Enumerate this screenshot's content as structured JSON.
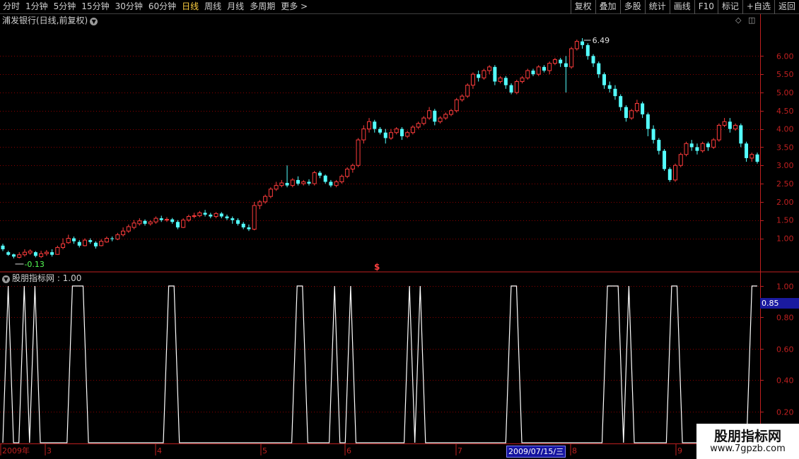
{
  "toolbar": {
    "periods": [
      "分时",
      "1分钟",
      "5分钟",
      "15分钟",
      "30分钟",
      "60分钟",
      "日线",
      "周线",
      "月线",
      "多周期",
      "更多 >"
    ],
    "active_period": "日线",
    "actions": [
      "复权",
      "叠加",
      "多股",
      "统计",
      "画线",
      "F10",
      "标记",
      "+自选",
      "返回"
    ]
  },
  "main_chart": {
    "title": "浦发银行(日线,前复权)",
    "high_label": "6.49",
    "low_label": "-0.13",
    "marker": "$",
    "y_ticks": [
      "6.00",
      "5.50",
      "5.00",
      "4.50",
      "4.00",
      "3.50",
      "3.00",
      "2.50",
      "2.00",
      "1.50",
      "1.00"
    ]
  },
  "indicator": {
    "title": "股朋指标网 : 1.00",
    "current_value": "0.85",
    "y_ticks": [
      "1.00",
      "0.80",
      "0.60",
      "0.40",
      "0.20"
    ]
  },
  "time_axis": {
    "labels": [
      "2009年",
      "3",
      "4",
      "5",
      "6",
      "7",
      "8",
      "9"
    ],
    "cursor_date": "2009/07/15/三"
  },
  "watermark": {
    "title": "股朋指标网",
    "url": "www.7gpzb.com"
  },
  "colors": {
    "up": "#ff3c3c",
    "down": "#54ffff",
    "grid": "#8a0000",
    "axis": "#c02020",
    "line": "#ffffff"
  },
  "chart_data": [
    {
      "type": "candlestick",
      "title": "浦发银行(日线,前复权)",
      "ylim": [
        0.1,
        6.8
      ],
      "y_ticks": [
        1.0,
        1.5,
        2.0,
        2.5,
        3.0,
        3.5,
        4.0,
        4.5,
        5.0,
        5.5,
        6.0
      ],
      "annotations": [
        {
          "text": "6.49",
          "kind": "max"
        },
        {
          "text": "-0.13",
          "kind": "min"
        }
      ],
      "series": [
        {
          "points": [
            [
              0.8,
              0.7,
              0.85,
              0.65
            ],
            [
              0.62,
              0.55,
              0.66,
              0.52
            ],
            [
              0.56,
              0.5,
              0.58,
              0.45
            ],
            [
              0.48,
              0.55,
              0.62,
              0.45
            ],
            [
              0.55,
              0.62,
              0.7,
              0.5
            ],
            [
              0.6,
              0.65,
              0.7,
              0.55
            ],
            [
              0.62,
              0.52,
              0.65,
              0.48
            ],
            [
              0.5,
              0.58,
              0.66,
              0.46
            ],
            [
              0.58,
              0.62,
              0.68,
              0.52
            ],
            [
              0.62,
              0.55,
              0.7,
              0.5
            ],
            [
              0.56,
              0.75,
              0.8,
              0.55
            ],
            [
              0.75,
              0.85,
              1.0,
              0.7
            ],
            [
              0.88,
              1.0,
              1.1,
              0.85
            ],
            [
              1.0,
              0.92,
              1.05,
              0.85
            ],
            [
              0.9,
              0.8,
              0.95,
              0.75
            ],
            [
              0.8,
              0.95,
              1.0,
              0.78
            ],
            [
              0.95,
              0.9,
              1.0,
              0.85
            ],
            [
              0.88,
              0.78,
              0.92,
              0.72
            ],
            [
              0.8,
              0.92,
              0.98,
              0.78
            ],
            [
              0.9,
              1.0,
              1.05,
              0.88
            ],
            [
              1.0,
              0.98,
              1.05,
              0.92
            ],
            [
              0.98,
              1.1,
              1.15,
              0.95
            ],
            [
              1.1,
              1.2,
              1.3,
              1.05
            ],
            [
              1.2,
              1.32,
              1.38,
              1.15
            ],
            [
              1.3,
              1.42,
              1.5,
              1.25
            ],
            [
              1.4,
              1.48,
              1.55,
              1.35
            ],
            [
              1.48,
              1.4,
              1.52,
              1.35
            ],
            [
              1.4,
              1.45,
              1.5,
              1.35
            ],
            [
              1.45,
              1.55,
              1.6,
              1.4
            ],
            [
              1.55,
              1.5,
              1.62,
              1.45
            ],
            [
              1.5,
              1.52,
              1.58,
              1.45
            ],
            [
              1.52,
              1.45,
              1.56,
              1.4
            ],
            [
              1.45,
              1.3,
              1.5,
              1.25
            ],
            [
              1.3,
              1.5,
              1.55,
              1.28
            ],
            [
              1.5,
              1.6,
              1.65,
              1.45
            ],
            [
              1.6,
              1.62,
              1.7,
              1.55
            ],
            [
              1.62,
              1.7,
              1.75,
              1.58
            ],
            [
              1.7,
              1.65,
              1.78,
              1.6
            ],
            [
              1.65,
              1.6,
              1.7,
              1.55
            ],
            [
              1.6,
              1.68,
              1.72,
              1.55
            ],
            [
              1.68,
              1.6,
              1.72,
              1.55
            ],
            [
              1.6,
              1.55,
              1.65,
              1.5
            ],
            [
              1.55,
              1.5,
              1.6,
              1.4
            ],
            [
              1.5,
              1.4,
              1.55,
              1.35
            ],
            [
              1.4,
              1.3,
              1.45,
              1.25
            ],
            [
              1.3,
              1.25,
              1.38,
              1.2
            ],
            [
              1.25,
              1.9,
              2.0,
              1.22
            ],
            [
              1.9,
              2.0,
              2.05,
              1.8
            ],
            [
              2.0,
              2.15,
              2.2,
              1.95
            ],
            [
              2.15,
              2.35,
              2.4,
              2.1
            ],
            [
              2.35,
              2.45,
              2.55,
              2.3
            ],
            [
              2.45,
              2.52,
              2.6,
              2.4
            ],
            [
              2.52,
              2.45,
              3.0,
              2.4
            ],
            [
              2.45,
              2.6,
              2.65,
              2.4
            ],
            [
              2.6,
              2.5,
              2.7,
              2.45
            ],
            [
              2.5,
              2.55,
              2.6,
              2.45
            ],
            [
              2.55,
              2.5,
              2.62,
              2.45
            ],
            [
              2.5,
              2.8,
              2.85,
              2.45
            ],
            [
              2.8,
              2.72,
              2.85,
              2.65
            ],
            [
              2.72,
              2.55,
              2.75,
              2.5
            ],
            [
              2.55,
              2.45,
              2.6,
              2.4
            ],
            [
              2.45,
              2.55,
              2.6,
              2.4
            ],
            [
              2.55,
              2.7,
              2.75,
              2.5
            ],
            [
              2.7,
              2.9,
              2.95,
              2.65
            ],
            [
              2.9,
              3.0,
              3.05,
              2.8
            ],
            [
              3.0,
              3.7,
              3.75,
              2.95
            ],
            [
              3.7,
              4.0,
              4.1,
              3.6
            ],
            [
              4.0,
              4.2,
              4.3,
              3.9
            ],
            [
              4.2,
              4.0,
              4.25,
              3.9
            ],
            [
              4.0,
              3.9,
              4.05,
              3.85
            ],
            [
              3.9,
              3.75,
              4.0,
              3.6
            ],
            [
              3.75,
              3.9,
              4.0,
              3.7
            ],
            [
              3.9,
              4.0,
              4.05,
              3.85
            ],
            [
              4.0,
              3.8,
              4.05,
              3.7
            ],
            [
              3.8,
              3.9,
              3.95,
              3.75
            ],
            [
              3.9,
              4.05,
              4.1,
              3.85
            ],
            [
              4.05,
              4.15,
              4.2,
              4.0
            ],
            [
              4.15,
              4.3,
              4.35,
              4.1
            ],
            [
              4.3,
              4.5,
              4.6,
              4.25
            ],
            [
              4.5,
              4.2,
              4.55,
              4.1
            ],
            [
              4.2,
              4.3,
              4.35,
              4.15
            ],
            [
              4.3,
              4.4,
              4.45,
              4.25
            ],
            [
              4.4,
              4.5,
              4.55,
              4.35
            ],
            [
              4.5,
              4.8,
              4.85,
              4.45
            ],
            [
              4.8,
              4.9,
              4.95,
              4.75
            ],
            [
              4.9,
              5.2,
              5.25,
              4.85
            ],
            [
              5.2,
              5.5,
              5.55,
              5.1
            ],
            [
              5.5,
              5.4,
              5.6,
              5.3
            ],
            [
              5.4,
              5.6,
              5.65,
              5.35
            ],
            [
              5.6,
              5.7,
              5.75,
              5.5
            ],
            [
              5.7,
              5.3,
              5.75,
              5.2
            ],
            [
              5.3,
              5.4,
              5.45,
              5.25
            ],
            [
              5.4,
              5.2,
              5.45,
              5.1
            ],
            [
              5.2,
              5.0,
              5.25,
              4.95
            ],
            [
              5.0,
              5.3,
              5.35,
              4.95
            ],
            [
              5.3,
              5.4,
              5.45,
              5.25
            ],
            [
              5.4,
              5.6,
              5.65,
              5.35
            ],
            [
              5.6,
              5.5,
              5.65,
              5.45
            ],
            [
              5.5,
              5.7,
              5.75,
              5.45
            ],
            [
              5.7,
              5.6,
              5.75,
              5.55
            ],
            [
              5.6,
              5.8,
              5.85,
              5.5
            ],
            [
              5.8,
              5.9,
              5.95,
              5.75
            ],
            [
              5.9,
              5.8,
              5.95,
              5.7
            ],
            [
              5.8,
              5.7,
              6.0,
              5.0
            ],
            [
              5.7,
              6.2,
              6.25,
              5.65
            ],
            [
              6.2,
              6.4,
              6.45,
              6.15
            ],
            [
              6.4,
              6.3,
              6.49,
              6.2
            ],
            [
              6.3,
              6.0,
              6.35,
              5.9
            ],
            [
              6.0,
              5.8,
              6.05,
              5.7
            ],
            [
              5.8,
              5.5,
              5.85,
              5.4
            ],
            [
              5.5,
              5.2,
              5.55,
              5.1
            ],
            [
              5.2,
              5.1,
              5.3,
              5.0
            ],
            [
              5.1,
              4.9,
              5.2,
              4.8
            ],
            [
              4.9,
              4.6,
              4.95,
              4.5
            ],
            [
              4.6,
              4.3,
              4.65,
              4.2
            ],
            [
              4.3,
              4.5,
              4.55,
              4.25
            ],
            [
              4.5,
              4.7,
              4.8,
              4.45
            ],
            [
              4.7,
              4.4,
              4.75,
              4.3
            ],
            [
              4.4,
              4.0,
              4.45,
              3.8
            ],
            [
              4.0,
              3.7,
              4.1,
              3.6
            ],
            [
              3.7,
              3.4,
              3.75,
              3.3
            ],
            [
              3.4,
              2.9,
              3.45,
              2.85
            ],
            [
              2.9,
              2.6,
              2.95,
              2.55
            ],
            [
              2.6,
              3.0,
              3.05,
              2.55
            ],
            [
              3.0,
              3.3,
              3.35,
              2.95
            ],
            [
              3.3,
              3.6,
              3.65,
              3.25
            ],
            [
              3.6,
              3.5,
              3.7,
              3.4
            ],
            [
              3.5,
              3.4,
              3.6,
              3.3
            ],
            [
              3.4,
              3.6,
              3.65,
              3.35
            ],
            [
              3.6,
              3.5,
              3.65,
              3.4
            ],
            [
              3.5,
              3.7,
              3.75,
              3.45
            ],
            [
              3.7,
              4.1,
              4.15,
              3.65
            ],
            [
              4.1,
              4.2,
              4.3,
              4.05
            ],
            [
              4.2,
              4.0,
              4.3,
              3.9
            ],
            [
              4.0,
              4.1,
              4.15,
              3.95
            ],
            [
              4.1,
              3.6,
              4.15,
              3.5
            ],
            [
              3.6,
              3.2,
              3.65,
              3.1
            ],
            [
              3.2,
              3.3,
              3.35,
              3.1
            ],
            [
              3.3,
              3.1,
              3.35,
              3.05
            ]
          ]
        }
      ]
    },
    {
      "type": "line",
      "title": "股朋指标网 : 1.00",
      "ylim": [
        0,
        1.0
      ],
      "y_ticks": [
        0.2,
        0.4,
        0.6,
        0.8,
        1.0
      ],
      "series": [
        {
          "values": [
            0,
            1,
            0,
            0,
            1,
            0,
            1,
            0,
            0,
            0,
            0,
            0,
            0,
            1,
            1,
            1,
            0,
            0,
            0,
            0,
            0,
            0,
            0,
            0,
            0,
            0,
            0,
            0,
            0,
            0,
            0,
            1,
            1,
            0,
            0,
            0,
            0,
            0,
            0,
            0,
            0,
            0,
            0,
            0,
            0,
            0,
            0,
            0,
            0,
            0,
            0,
            0,
            0,
            0,
            0,
            1,
            1,
            0,
            0,
            0,
            0,
            0,
            1,
            0,
            0,
            1,
            0,
            0,
            0,
            0,
            0,
            0,
            0,
            0,
            0,
            0,
            1,
            0,
            1,
            0,
            0,
            0,
            0,
            0,
            0,
            0,
            0,
            0,
            0,
            0,
            0,
            0,
            0,
            0,
            0,
            1,
            1,
            0,
            0,
            0,
            0,
            0,
            0,
            0,
            0,
            0,
            0,
            0,
            0,
            0,
            0,
            0,
            0,
            1,
            1,
            1,
            0,
            1,
            0,
            0,
            0,
            0,
            0,
            0,
            0,
            1,
            1,
            0,
            0,
            0,
            0,
            0,
            0,
            0,
            0,
            0,
            0,
            0,
            0,
            0,
            1,
            1
          ]
        }
      ]
    }
  ]
}
